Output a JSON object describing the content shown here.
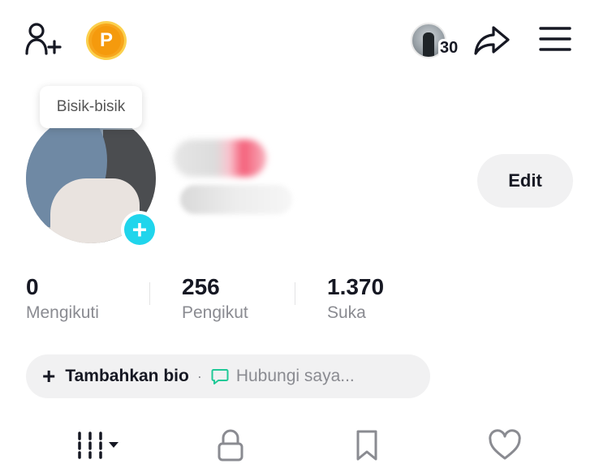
{
  "header": {
    "icons": [
      "add-user-icon",
      "coin-icon",
      "visitors-avatar",
      "share-icon",
      "menu-icon"
    ],
    "coin_letter": "P",
    "visitor_count": "30",
    "coin_color": "#f7a51c"
  },
  "profile": {
    "tooltip": "Bisik-bisik",
    "edit_label": "Edit",
    "add_avatar_symbol": "+"
  },
  "stats": [
    {
      "value": "0",
      "label": "Mengikuti"
    },
    {
      "value": "256",
      "label": "Pengikut"
    },
    {
      "value": "1.370",
      "label": "Suka"
    }
  ],
  "bio": {
    "plus": "+",
    "add_label": "Tambahkan bio",
    "separator": "·",
    "contact_label": "Hubungi saya...",
    "accent": "#20c997"
  },
  "tabs": [
    "videos-grid-icon",
    "lock-icon",
    "bookmark-icon",
    "heart-icon"
  ],
  "colors": {
    "accent_blue": "#20d5ec",
    "text_primary": "#161823",
    "text_secondary": "#8a8b91"
  }
}
